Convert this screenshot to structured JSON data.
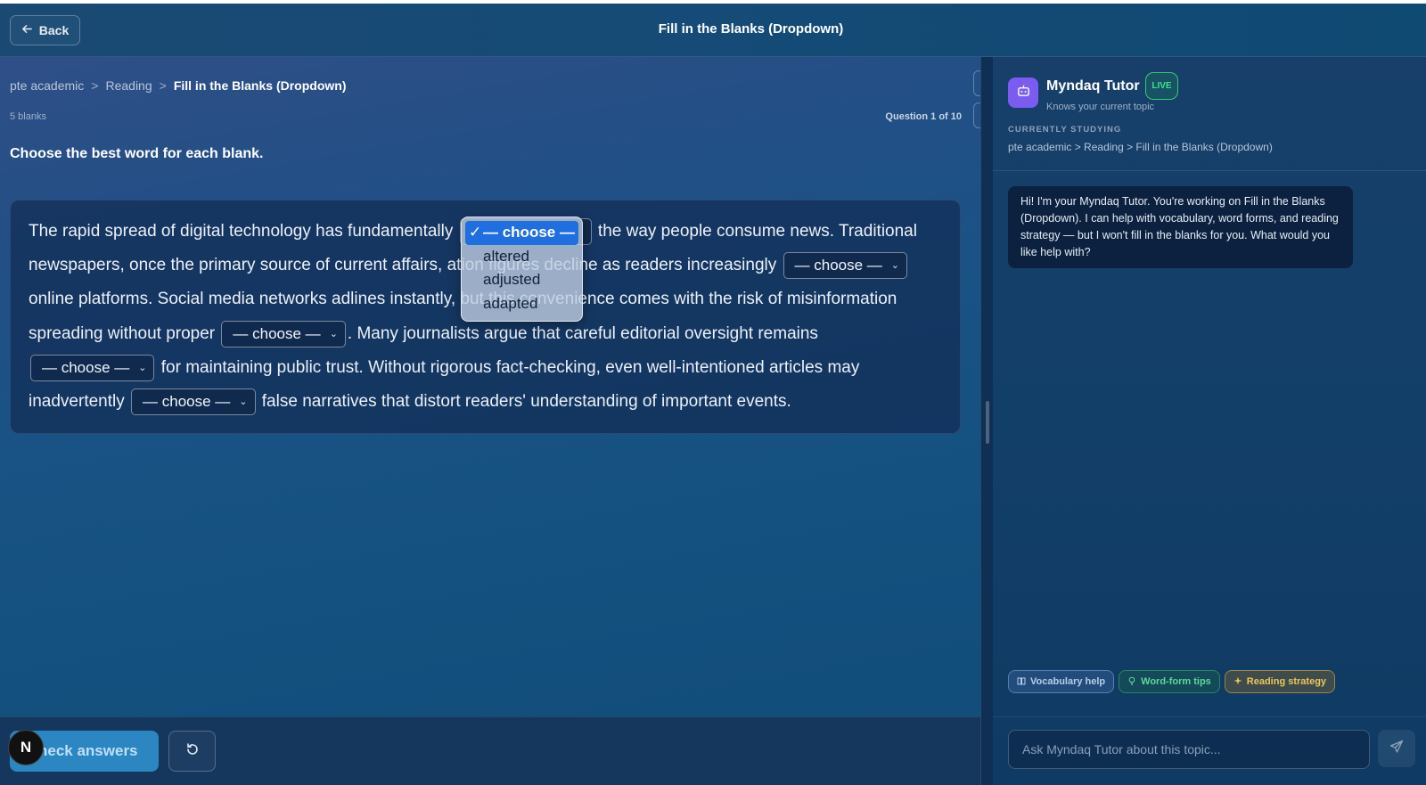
{
  "header": {
    "back_label": "Back",
    "title": "Fill in the Blanks (Dropdown)"
  },
  "breadcrumb": {
    "items": [
      "pte academic",
      "Reading",
      "Fill in the Blanks (Dropdown)"
    ],
    "separator": ">"
  },
  "meta": {
    "blanks_count": "5 blanks",
    "question_count": "Question 1 of 10"
  },
  "instruction": "Choose the best word for each blank.",
  "passage": {
    "segments": [
      "The rapid spread of digital technology has fundamentally",
      "the way people consume news. Traditional newspapers, once the primary source of current affairs,",
      "ation figures decline as readers increasingly",
      "online platforms. Social media networks",
      "adlines instantly, but this convenience comes with the risk of misinformation spreading without proper",
      ". Many journalists argue that careful editorial oversight remains",
      "for maintaining public trust. Without rigorous fact-checking, even well-intentioned articles may inadvertently",
      "false narratives that distort readers' understanding of important events."
    ],
    "select_placeholder": "— choose —"
  },
  "dropdown": {
    "selected": "— choose —",
    "options": [
      "altered",
      "adjusted",
      "adapted"
    ]
  },
  "actions": {
    "check_label": "heck answers",
    "badge_letter": "N"
  },
  "tutor": {
    "name": "Myndaq Tutor",
    "live": "LIVE",
    "subtitle": "Knows your current topic",
    "studying_label": "CURRENTLY STUDYING",
    "studying_path": "pte academic > Reading > Fill in the Blanks (Dropdown)",
    "message": "Hi! I'm your Myndaq Tutor. You're working on Fill in the Blanks (Dropdown). I can help with vocabulary, word forms, and reading strategy — but I won't fill in the blanks for you. What would you like help with?",
    "chips": [
      "Vocabulary help",
      "Word-form tips",
      "Reading strategy"
    ],
    "input_placeholder": "Ask Myndaq Tutor about this topic..."
  },
  "colors": {
    "accent": "#2b86c2",
    "live": "#40e08b",
    "avatar": "#7c5cf0",
    "dropdown_selected": "#1f6fe0"
  }
}
